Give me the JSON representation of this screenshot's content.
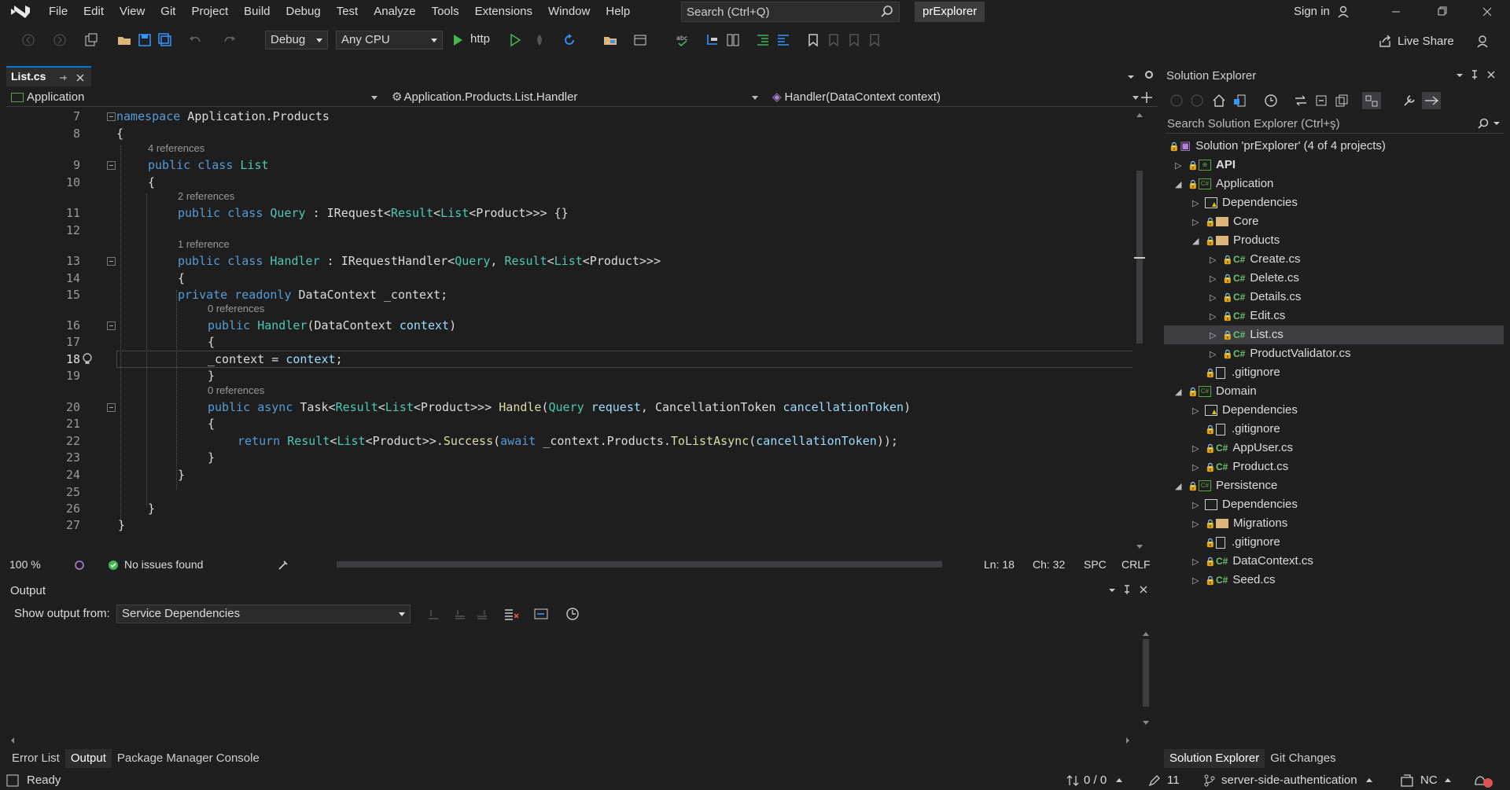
{
  "menu": [
    "File",
    "Edit",
    "View",
    "Git",
    "Project",
    "Build",
    "Debug",
    "Test",
    "Analyze",
    "Tools",
    "Extensions",
    "Window",
    "Help"
  ],
  "search": {
    "placeholder": "Search (Ctrl+Q)"
  },
  "solution_name": "prExplorer",
  "signin": "Sign in",
  "toolbar": {
    "config": "Debug",
    "platform": "Any CPU",
    "run_target": "http",
    "live_share": "Live Share"
  },
  "editor": {
    "tab": "List.cs",
    "nav_project": "Application",
    "nav_type": "Application.Products.List.Handler",
    "nav_member": "Handler(DataContext context)",
    "zoom": "100 %",
    "issues": "No issues found",
    "line": "Ln: 18",
    "col": "Ch: 32",
    "spc": "SPC",
    "eol": "CRLF",
    "line_numbers": [
      "7",
      "8",
      "9",
      "10",
      "11",
      "12",
      "13",
      "14",
      "15",
      "16",
      "17",
      "18",
      "19",
      "20",
      "21",
      "22",
      "23",
      "24",
      "25",
      "26",
      "27"
    ],
    "lens": {
      "l9": "4 references",
      "l11": "2 references",
      "l13": "1 reference",
      "l16": "0 references",
      "l20": "0 references"
    },
    "code": {
      "l7_kw": "namespace",
      "l7_rest": " Application.Products",
      "l8": "{",
      "l9_kw": "public class",
      "l9_name": " List",
      "l10": "{",
      "l11_kw": "public class",
      "l11_name": " Query",
      "l11_a": " : IRequest<",
      "l11_t1": "Result",
      "l11_b": "<",
      "l11_t2": "List",
      "l11_c": "<Product>>> {}",
      "l13_kw": "public class",
      "l13_name": " Handler",
      "l13_a": " : IRequestHandler<",
      "l13_t1": "Query",
      "l13_b": ", ",
      "l13_t2": "Result",
      "l13_c": "<",
      "l13_t3": "List",
      "l13_d": "<Product>>>",
      "l14": "{",
      "l15_kw": "private readonly",
      "l15_rest": " DataContext _context;",
      "l16_kw": "public",
      "l16_fn": " Handler",
      "l16_a": "(DataContext ",
      "l16_pm": "context",
      "l16_b": ")",
      "l17": "{",
      "l18_a": "_context = ",
      "l18_pm": "context",
      "l18_b": ";",
      "l19": "}",
      "l20_kw": "public async",
      "l20_a": " Task<",
      "l20_t1": "Result",
      "l20_b": "<",
      "l20_t2": "List",
      "l20_c": "<Product>>> ",
      "l20_fn": "Handle",
      "l20_d": "(",
      "l20_t3": "Query",
      "l20_e": " ",
      "l20_pm1": "request",
      "l20_f": ", CancellationToken ",
      "l20_pm2": "cancellationToken",
      "l20_g": ")",
      "l21": "{",
      "l22_kw": "return",
      "l22_t1": " Result",
      "l22_a": "<",
      "l22_t2": "List",
      "l22_b": "<Product>>.",
      "l22_fn": "Success",
      "l22_c": "(",
      "l22_kw2": "await",
      "l22_d": " _context.Products.",
      "l22_fn2": "ToListAsync",
      "l22_e": "(",
      "l22_pm": "cancellationToken",
      "l22_f": "));",
      "l23": "}",
      "l24": "}",
      "l26": "}",
      "l27": "}"
    }
  },
  "output": {
    "title": "Output",
    "show_from_label": "Show output from:",
    "source": "Service Dependencies"
  },
  "bottom_tabs": [
    "Error List",
    "Output",
    "Package Manager Console"
  ],
  "solution_explorer": {
    "title": "Solution Explorer",
    "search_placeholder": "Search Solution Explorer (Ctrl+ş)",
    "tree": [
      "Solution 'prExplorer' (4 of 4 projects)",
      "API",
      "Application",
      "Dependencies",
      "Core",
      "Products",
      "Create.cs",
      "Delete.cs",
      "Details.cs",
      "Edit.cs",
      "List.cs",
      "ProductValidator.cs",
      ".gitignore",
      "Domain",
      "Dependencies",
      ".gitignore",
      "AppUser.cs",
      "Product.cs",
      "Persistence",
      "Dependencies",
      "Migrations",
      ".gitignore",
      "DataContext.cs",
      "Seed.cs"
    ],
    "tabs": [
      "Solution Explorer",
      "Git Changes"
    ]
  },
  "statusbar": {
    "ready": "Ready",
    "sync": "0 / 0",
    "changes": "11",
    "branch": "server-side-authentication",
    "user": "NC"
  },
  "colors": {
    "accent": "#0078d4",
    "keyword": "#569cd6",
    "type": "#4ec9b0",
    "param": "#9cdcfe",
    "method": "#dcdcaa",
    "ok": "#3fb950"
  }
}
